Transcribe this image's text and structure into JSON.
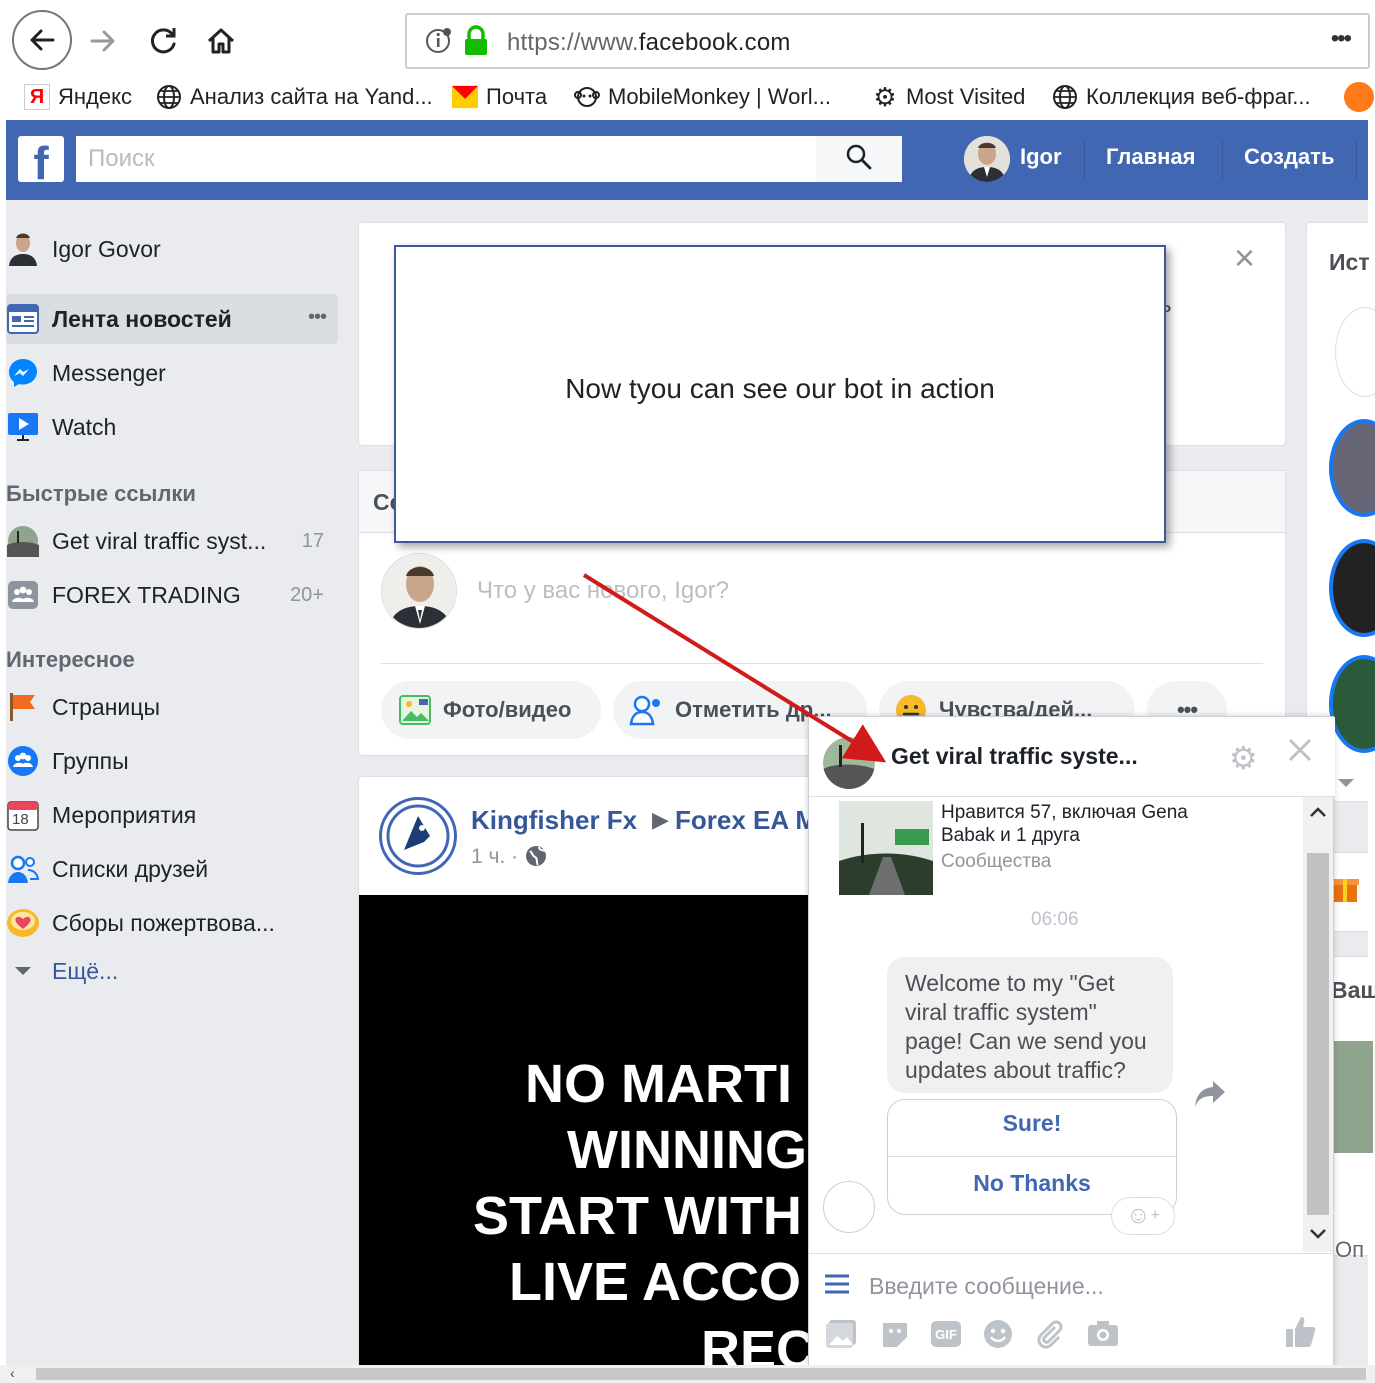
{
  "browser": {
    "url_prefix": "https://www.",
    "url_domain": "facebook.com",
    "menu_label": "•••",
    "bookmarks": [
      {
        "label": "Яндекс",
        "icon": "yandex-icon"
      },
      {
        "label": "Анализ сайта на Yand...",
        "icon": "globe-icon"
      },
      {
        "label": "Почта",
        "icon": "mail-icon"
      },
      {
        "label": "MobileMonkey | Worl...",
        "icon": "monkey-icon"
      },
      {
        "label": "Most Visited",
        "icon": "gear-icon"
      },
      {
        "label": "Коллекция веб-фраг...",
        "icon": "globe-icon"
      }
    ]
  },
  "header": {
    "search_placeholder": "Поиск",
    "user_name": "Igor",
    "home_label": "Главная",
    "create_label": "Создать"
  },
  "sidebar": {
    "user_full_name": "Igor Govor",
    "main_items": [
      {
        "label": "Лента новостей",
        "more": "•••"
      },
      {
        "label": "Messenger"
      },
      {
        "label": "Watch"
      }
    ],
    "shortcuts_heading": "Быстрые ссылки",
    "shortcuts": [
      {
        "label": "Get viral traffic syst...",
        "count": "17"
      },
      {
        "label": "FOREX TRADING",
        "count": "20+"
      }
    ],
    "explore_heading": "Интересное",
    "explore": [
      {
        "label": "Страницы"
      },
      {
        "label": "Группы"
      },
      {
        "label": "Мероприятия",
        "badge": "18"
      },
      {
        "label": "Списки друзей"
      },
      {
        "label": "Сборы пожертвова..."
      }
    ],
    "more_label": "Ещё..."
  },
  "feed": {
    "close_label": "×",
    "composer_tab_partial": "Со",
    "composer_placeholder": "Что у вас нового, Igor?",
    "actions": [
      "Фото/видео",
      "Отметить др...",
      "Чувства/дей...",
      "•••"
    ],
    "post_author": "Kingfisher Fx",
    "post_target": "Forex EA M",
    "post_time": "1 ч. ·",
    "post_image_lines": [
      "NO MARTI",
      "WINNING",
      "START WITH",
      "LIVE ACCO",
      "REC"
    ]
  },
  "overlay": {
    "text": "Now tyou can see our bot in action",
    "hidden_char": "ь"
  },
  "chat": {
    "title": "Get viral traffic syste...",
    "page_likes": "Нравится 57, включая Gena Babak и 1 друга",
    "page_category": "Сообщества",
    "timestamp": "06:06",
    "message": "Welcome to my \"Get viral traffic system\" page! Can we send you updates about traffic?",
    "quick_replies": [
      "Sure!",
      "No Thanks"
    ],
    "input_placeholder": "Введите сообщение..."
  },
  "right_column": {
    "stories_partial": "Ист",
    "section2_partial": "Ваш",
    "section3_partial": "Оп"
  },
  "colors": {
    "fb_blue": "#4267b2",
    "link_blue": "#365899",
    "arrow_red": "#d11a1a"
  }
}
